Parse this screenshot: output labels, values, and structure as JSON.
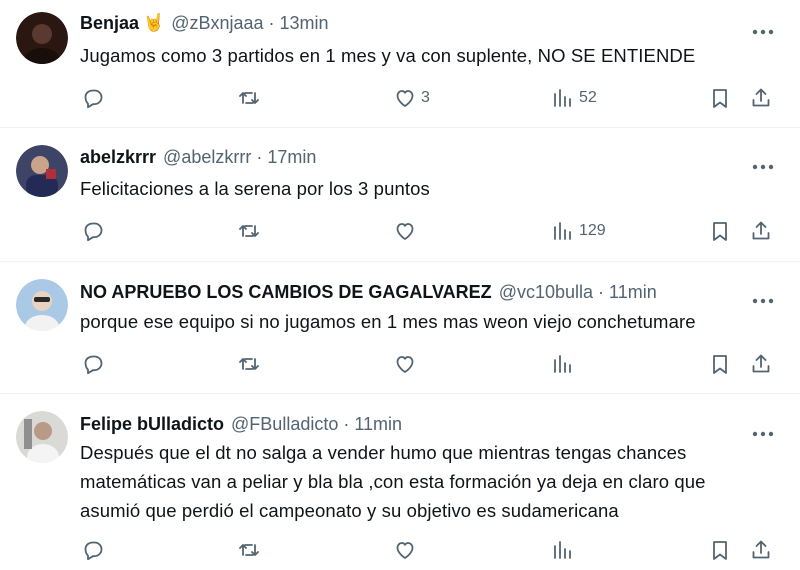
{
  "tweets": [
    {
      "name": "Benjaa",
      "emoji": "🤘",
      "handle": "@zBxnjaaa",
      "separator": "·",
      "time": "13min",
      "text": "Jugamos como 3 partidos en 1 mes y va con suplente, NO SE ENTIENDE",
      "likes": "3",
      "views": "52",
      "avatar_color": "#2b1712"
    },
    {
      "name": "abelzkrrr",
      "handle": "@abelzkrrr",
      "separator": "·",
      "time": "17min",
      "text": "Felicitaciones a la serena por los 3 puntos",
      "likes": "",
      "views": "129",
      "avatar_color": "#3d4466"
    },
    {
      "name": "NO APRUEBO LOS CAMBIOS DE GAGALVAREZ",
      "handle": "@vc10bulla",
      "separator": "·",
      "time": "11min",
      "text": "porque ese equipo si no jugamos en 1 mes mas weon viejo conchetumare",
      "likes": "",
      "views": "",
      "avatar_color": "#a9c9e6"
    },
    {
      "name": "Felipe bUlladicto",
      "handle": "@FBulladicto",
      "separator": "·",
      "time": "11min",
      "text": "Después que el dt no salga a vender humo que mientras tengas chances\nmatemáticas van a peliar y bla bla ,con esta formación ya deja en claro que\nasumió que perdió el campeonato y su objetivo es sudamericana",
      "likes": "",
      "views": "",
      "avatar_color": "#d9d9d6"
    }
  ],
  "icons": [
    "more-icon",
    "reply-icon",
    "retweet-icon",
    "like-icon",
    "views-icon",
    "bookmark-icon",
    "share-icon"
  ],
  "colors": {
    "text": "#0f1419",
    "secondary": "#536471",
    "divider": "#eff3f4"
  }
}
